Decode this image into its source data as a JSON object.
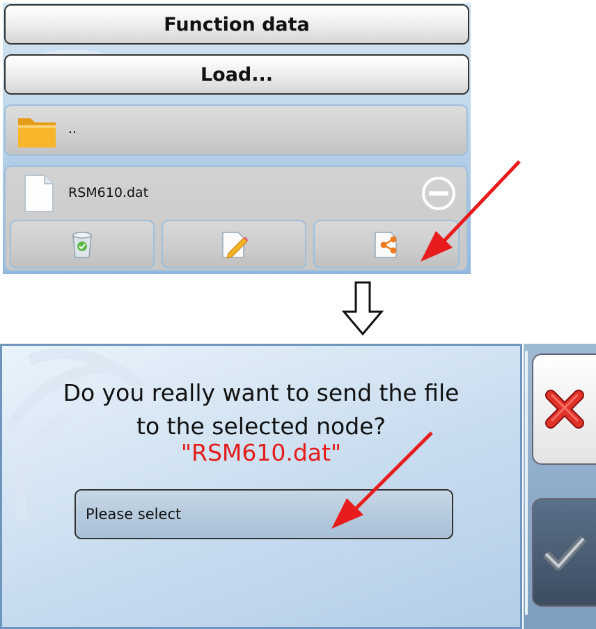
{
  "file_browser": {
    "header_title": "Function data",
    "load_button_label": "Load...",
    "parent_folder_label": "..",
    "selected_file": {
      "name": "RSM610.dat",
      "actions": [
        "delete-icon",
        "rename-icon",
        "share-icon"
      ]
    }
  },
  "confirm_dialog": {
    "question": "Do you really want to send the file to the selected node?",
    "question_line1": "Do you really want to send the file",
    "question_line2": "to the selected node?",
    "file_label": "\"RSM610.dat\"",
    "node_select_placeholder": "Please select",
    "cancel_icon": "cancel-x-icon",
    "confirm_icon": "checkmark-icon"
  },
  "colors": {
    "annotation_arrow": "#e81c1c",
    "file_label": "#e41c1c",
    "panel_blue": "#8fb7dd"
  }
}
